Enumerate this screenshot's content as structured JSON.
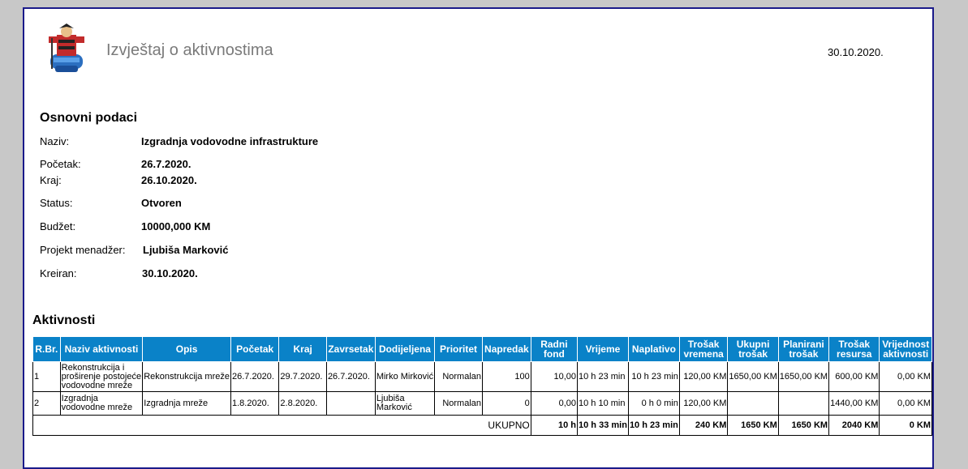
{
  "header": {
    "title": "Izvještaj o aktivnostima",
    "date": "30.10.2020."
  },
  "basic": {
    "section_title": "Osnovni podaci",
    "fields": [
      {
        "label": "Naziv:",
        "value": "Izgradnja vodovodne infrastrukture"
      },
      {
        "label": "Početak:",
        "value": "26.7.2020."
      },
      {
        "label": "Kraj:",
        "value": "26.10.2020."
      },
      {
        "label": "Status:",
        "value": "Otvoren"
      },
      {
        "label": "Budžet:",
        "value": "10000,000 KM"
      },
      {
        "label": "Projekt menadžer:",
        "value": "Ljubiša Marković"
      },
      {
        "label": "Kreiran:",
        "value": "30.10.2020."
      }
    ]
  },
  "activities": {
    "section_title": "Aktivnosti",
    "columns": [
      "R.Br.",
      "Naziv aktivnosti",
      "Opis",
      "Početak",
      "Kraj",
      "Zavrsetak",
      "Dodijeljena",
      "Prioritet",
      "Napredak",
      "Radni fond",
      "Vrijeme",
      "Naplativo",
      "Trošak vremena",
      "Ukupni trošak",
      "Planirani trošak",
      "Trošak resursa",
      "Vrijednost aktivnosti"
    ],
    "rows": [
      [
        "1",
        "Rekonstrukcija i proširenje postojeće vodovodne mreže",
        "Rekonstrukcija mreže",
        "26.7.2020.",
        "29.7.2020.",
        "26.7.2020.",
        "Mirko Mirković",
        "Normalan",
        "100",
        "10,00",
        "10 h  23 min",
        "10 h  23 min",
        "120,00 KM",
        "1650,00 KM",
        "1650,00 KM",
        "600,00 KM",
        "0,00 KM"
      ],
      [
        "2",
        "Izgradnja vodovodne mreže",
        "Izgradnja mreže",
        "1.8.2020.",
        "2.8.2020.",
        "",
        "Ljubiša Marković",
        "Normalan",
        "0",
        "0,00",
        "10 h  10 min",
        "0 h  0 min",
        "120,00 KM",
        "",
        "",
        "1440,00 KM",
        "0,00 KM"
      ]
    ],
    "total": {
      "label": "UKUPNO",
      "values": [
        "10 h",
        "10 h 33 min",
        "10 h 23 min",
        "240 KM",
        "1650 KM",
        "1650 KM",
        "2040 KM",
        "0 KM"
      ]
    }
  }
}
